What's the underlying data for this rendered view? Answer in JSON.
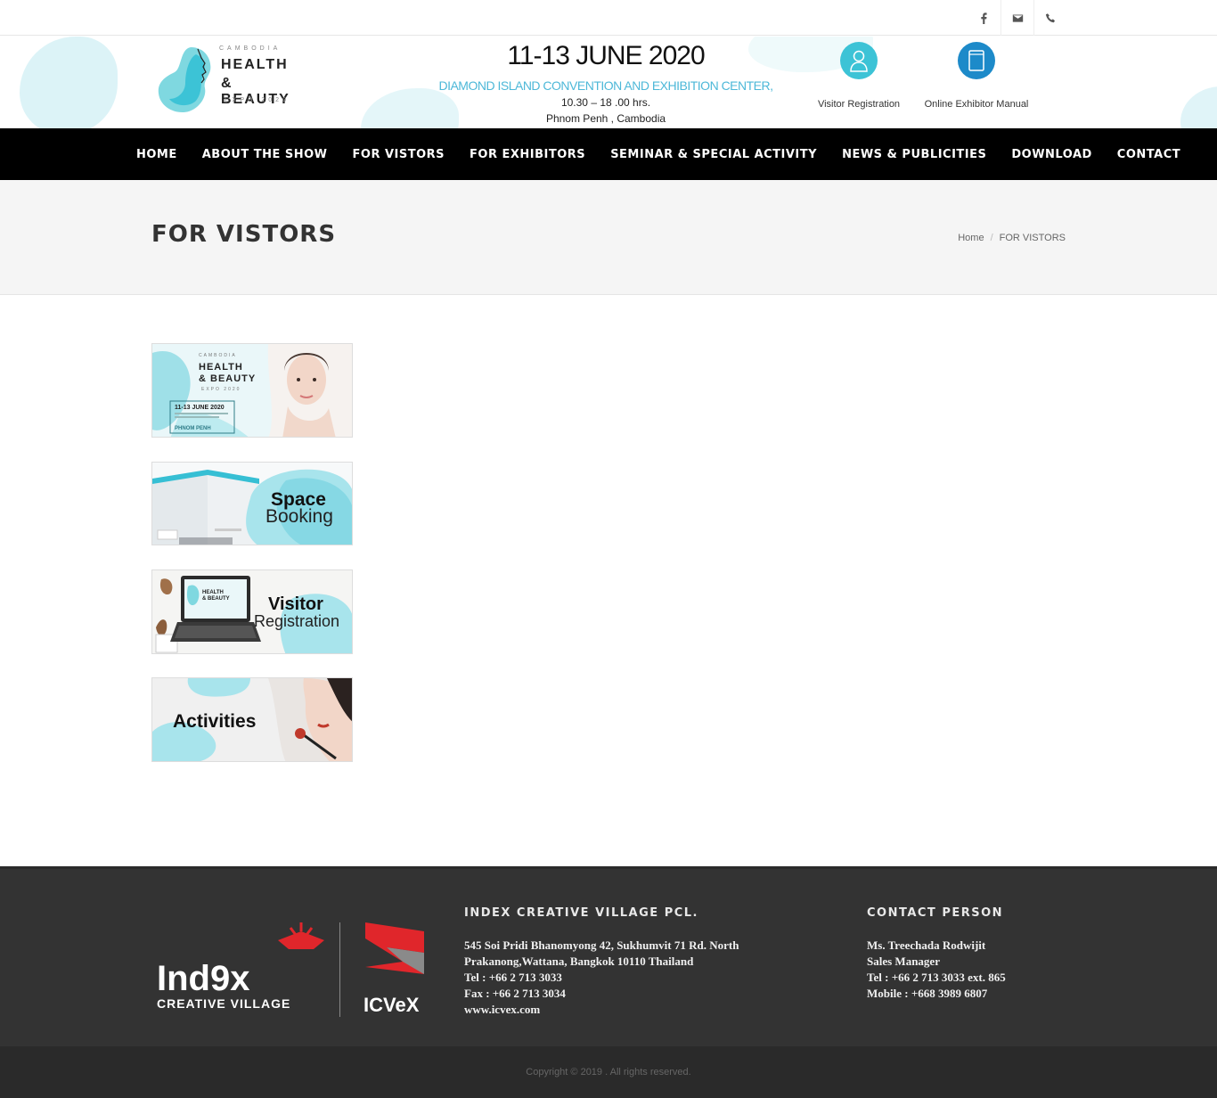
{
  "topbar": {
    "icons": [
      "facebook-icon",
      "mail-icon",
      "phone-icon"
    ]
  },
  "header": {
    "logo": {
      "country": "CAMBODIA",
      "line1": "HEALTH",
      "line2": "& BEAUTY",
      "edition": "EXPO 2020"
    },
    "event": {
      "date": "11-13 JUNE 2020",
      "venue": "DIAMOND ISLAND CONVENTION AND EXHIBITION CENTER,",
      "time": "10.30 – 18 .00 hrs.",
      "city": "Phnom Penh , Cambodia"
    },
    "buttons": [
      {
        "label": "Visitor Registration",
        "icon": "user-icon",
        "color": "#3cc3d6"
      },
      {
        "label": "Online Exhibitor Manual",
        "icon": "book-icon",
        "color": "#1d8ac9"
      }
    ]
  },
  "nav": {
    "items": [
      "HOME",
      "ABOUT THE SHOW",
      "FOR VISTORS",
      "FOR EXHIBITORS",
      "SEMINAR & SPECIAL ACTIVITY",
      "NEWS & PUBLICITIES",
      "DOWNLOAD",
      "CONTACT"
    ]
  },
  "page": {
    "title": "FOR VISTORS",
    "breadcrumb": [
      "Home",
      "FOR VISTORS"
    ]
  },
  "banners": [
    {
      "name": "expo-banner",
      "lines": [
        "CAMBODIA",
        "HEALTH",
        "& BEAUTY",
        "EXPO 2020",
        "11-13 JUNE 2020",
        "PHNOM PENH"
      ]
    },
    {
      "name": "space-booking-banner",
      "lines": [
        "Space",
        "Booking"
      ]
    },
    {
      "name": "visitor-registration-banner",
      "lines": [
        "Visitor",
        "Registration"
      ]
    },
    {
      "name": "activities-banner",
      "lines": [
        "Activities"
      ]
    }
  ],
  "footer": {
    "logo": {
      "text1": "Ind9x",
      "text2": "CREATIVE VILLAGE",
      "text3": "ICVeX"
    },
    "company": {
      "heading": "INDEX CREATIVE VILLAGE PCL.",
      "lines": [
        "545 Soi Pridi Bhanomyong 42, Sukhumvit 71 Rd. North",
        "Prakanong,Wattana, Bangkok 10110 Thailand",
        "Tel : +66 2 713 3033",
        "Fax : +66 2 713 3034",
        "www.icvex.com"
      ]
    },
    "contact": {
      "heading": "CONTACT PERSON",
      "lines": [
        "Ms. Treechada Rodwijit",
        "Sales Manager",
        "Tel : +66 2 713 3033 ext. 865",
        "Mobile : +668 3989 6807"
      ]
    },
    "copyright": "Copyright © 2019 . All rights reserved."
  },
  "colors": {
    "accent": "#3cc3d6",
    "accent_dark": "#1d8ac9",
    "nav_bg": "#000000",
    "footer_bg": "#333333"
  }
}
